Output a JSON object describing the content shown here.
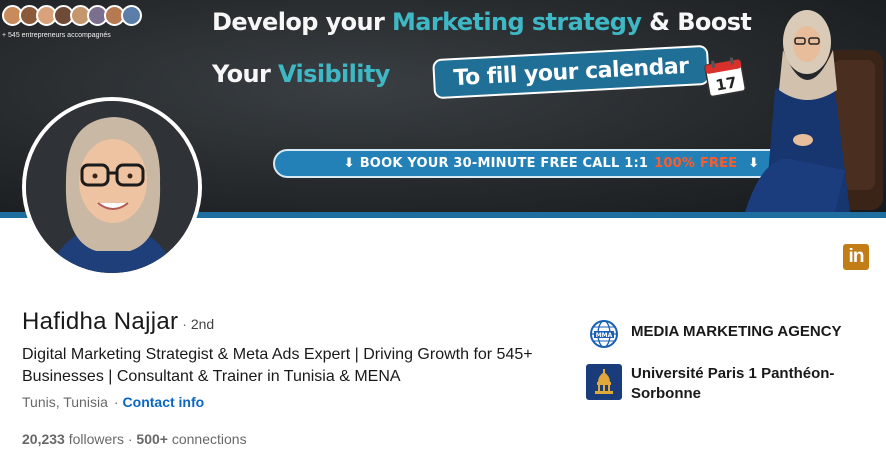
{
  "banner": {
    "count_text": "+ 545 entrepreneurs accompagnés",
    "line1_prefix": "Develop your ",
    "line1_accent": "Marketing strategy",
    "line1_suffix": " & Boost",
    "line2_prefix": "Your ",
    "line2_accent": "Visibility",
    "fill_badge": "To fill your calendar",
    "calendar_day": "17",
    "cta_prefix": "BOOK YOUR 30-MINUTE FREE CALL 1:1",
    "cta_free": "100% FREE",
    "cta_arrow": "⬇",
    "colors": {
      "accent": "#3fb8c6",
      "cta": "#2381b7",
      "free": "#ff5a2a",
      "strip": "#1e6fa0"
    }
  },
  "profile": {
    "name": "Hafidha Najjar",
    "degree_sep": "·",
    "degree": "2nd",
    "headline": "Digital Marketing Strategist & Meta Ads Expert | Driving Growth for 545+ Businesses | Consultant & Trainer in Tunisia & MENA",
    "location": "Tunis, Tunisia",
    "location_sep": "·",
    "contact_info": "Contact info",
    "followers_count": "20,233",
    "followers_label": "followers",
    "stats_sep": "·",
    "connections_count": "500+",
    "connections_label": "connections"
  },
  "right_column": {
    "company": "MEDIA MARKETING AGENCY",
    "company_logo_text": "MMA",
    "education": "Université Paris 1 Panthéon-Sorbonne"
  },
  "corner_logo": {
    "icon": "linkedin-icon",
    "text": "in",
    "color": "#c37d16"
  },
  "icons": {
    "company_logo": "globe-icon",
    "education_logo": "pantheon-icon",
    "calendar": "calendar-icon"
  }
}
